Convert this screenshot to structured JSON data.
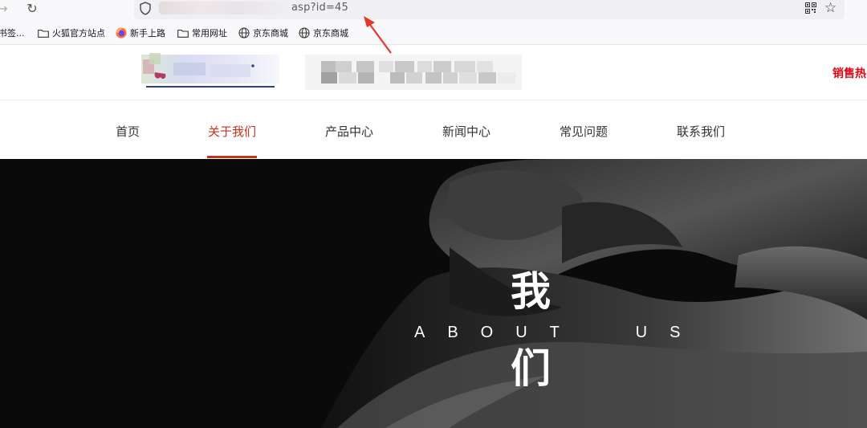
{
  "browser": {
    "back_glyph": "→",
    "reload_glyph": "↻",
    "url_visible": "asp?id=45",
    "star_glyph": "☆",
    "icons": [
      "shield-icon",
      "qr-code-icon",
      "star-icon"
    ]
  },
  "bookmarks": [
    {
      "label": "书签...",
      "icon": "none"
    },
    {
      "label": "火狐官方站点",
      "icon": "folder-icon"
    },
    {
      "label": "新手上路",
      "icon": "firefox-icon"
    },
    {
      "label": "常用网址",
      "icon": "folder-icon"
    },
    {
      "label": "京东商城",
      "icon": "globe-icon"
    },
    {
      "label": "京东商城",
      "icon": "globe-icon"
    }
  ],
  "header": {
    "hotline_label": "销售热"
  },
  "nav": {
    "items": [
      {
        "label": "首页"
      },
      {
        "label": "关于我们",
        "active": true
      },
      {
        "label": "产品中心"
      },
      {
        "label": "新闻中心"
      },
      {
        "label": "常见问题"
      },
      {
        "label": "联系我们"
      }
    ],
    "active_color": "#c8301e"
  },
  "banner": {
    "title_char_1": "我",
    "title_char_2": "们",
    "subtitle": "ABOUT  US"
  },
  "colors": {
    "accent_red": "#e60012",
    "arrow_red": "#e8352a"
  }
}
